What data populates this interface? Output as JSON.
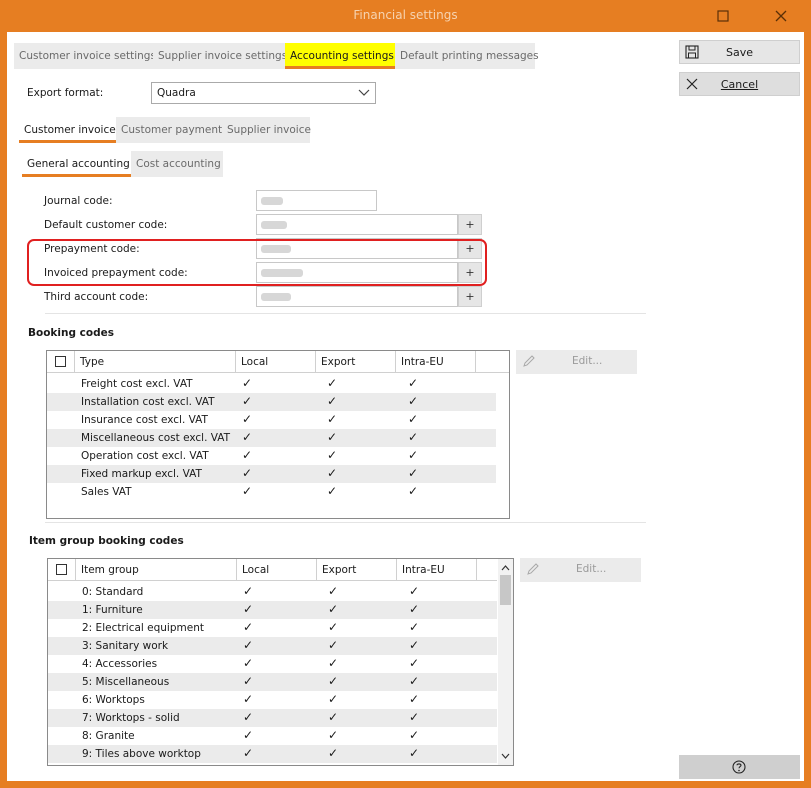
{
  "window": {
    "title": "Financial settings",
    "minimize_icon": "square",
    "close_icon": "x"
  },
  "main_tabs": [
    {
      "label": "Customer invoice settings"
    },
    {
      "label": "Supplier invoice settings"
    },
    {
      "label": "Accounting settings",
      "active": true
    },
    {
      "label": "Default printing messages"
    }
  ],
  "export_format": {
    "label": "Export format:",
    "value": "Quadra"
  },
  "invoice_tabs": [
    {
      "label": "Customer invoice",
      "active": true
    },
    {
      "label": "Customer payment"
    },
    {
      "label": "Supplier invoice"
    }
  ],
  "accounting_tabs": [
    {
      "label": "General accounting",
      "active": true
    },
    {
      "label": "Cost accounting"
    }
  ],
  "fields": {
    "journal_code": "Journal code:",
    "default_customer_code": "Default customer code:",
    "prepayment_code": "Prepayment code:",
    "invoiced_prepayment_code": "Invoiced prepayment code:",
    "third_account_code": "Third account code:",
    "plus": "+"
  },
  "booking_codes": {
    "title": "Booking codes",
    "columns": [
      "Type",
      "Local",
      "Export",
      "Intra-EU"
    ],
    "edit_label": "Edit...",
    "rows": [
      "Freight cost excl. VAT",
      "Installation cost excl. VAT",
      "Insurance cost excl. VAT",
      "Miscellaneous cost excl. VAT",
      "Operation cost excl. VAT",
      "Fixed markup excl. VAT",
      "Sales VAT"
    ],
    "check": "✓"
  },
  "item_group_codes": {
    "title": "Item group booking codes",
    "columns": [
      "Item group",
      "Local",
      "Export",
      "Intra-EU"
    ],
    "edit_label": "Edit...",
    "rows": [
      "0: Standard",
      "1: Furniture",
      "2: Electrical equipment",
      "3: Sanitary work",
      "4: Accessories",
      "5: Miscellaneous",
      "6: Worktops",
      "7: Worktops - solid",
      "8: Granite",
      "9: Tiles above worktop"
    ],
    "check": "✓"
  },
  "actions": {
    "save": "Save",
    "cancel": "Cancel",
    "help_icon": "question-circle"
  },
  "colors": {
    "accent": "#e67e22",
    "tab_highlight": "#ffff00",
    "annotation": "#e02020"
  }
}
